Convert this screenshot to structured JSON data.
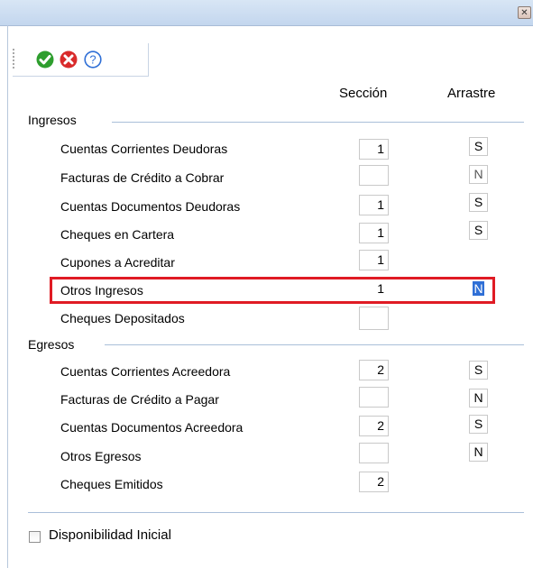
{
  "window": {
    "close_glyph": "✕"
  },
  "toolbar": {
    "accept_icon": "check-circle-icon",
    "cancel_icon": "x-circle-icon",
    "help_icon": "question-circle-icon",
    "help_glyph": "?"
  },
  "columns": {
    "seccion": "Sección",
    "arrastre": "Arrastre"
  },
  "ingresos": {
    "label": "Ingresos",
    "rows": [
      {
        "label": "Cuentas Corrientes Deudoras",
        "seccion": "1",
        "arrastre": "S"
      },
      {
        "label": "Facturas de Crédito a Cobrar",
        "seccion": "",
        "arrastre": "N"
      },
      {
        "label": "Cuentas Documentos Deudoras",
        "seccion": "1",
        "arrastre": "S"
      },
      {
        "label": "Cheques en Cartera",
        "seccion": "1",
        "arrastre": "S"
      },
      {
        "label": "Cupones a Acreditar",
        "seccion": "1",
        "arrastre": ""
      },
      {
        "label": "Otros Ingresos",
        "seccion": "1",
        "arrastre": "N"
      },
      {
        "label": "Cheques Depositados",
        "seccion": "",
        "arrastre": ""
      }
    ]
  },
  "egresos": {
    "label": "Egresos",
    "rows": [
      {
        "label": "Cuentas Corrientes Acreedora",
        "seccion": "2",
        "arrastre": "S"
      },
      {
        "label": "Facturas de Crédito a Pagar",
        "seccion": "",
        "arrastre": "N"
      },
      {
        "label": "Cuentas Documentos Acreedora",
        "seccion": "2",
        "arrastre": "S"
      },
      {
        "label": "Otros Egresos",
        "seccion": "",
        "arrastre": "N"
      },
      {
        "label": "Cheques Emitidos",
        "seccion": "2",
        "arrastre": ""
      }
    ]
  },
  "footer": {
    "disponibilidad_label": "Disponibilidad Inicial",
    "disponibilidad_checked": false
  },
  "colors": {
    "highlight": "#e01b24",
    "accept": "#2e9e2e",
    "cancel": "#d92b2b",
    "help": "#2f6fd6",
    "selection": "#2f6fd6"
  }
}
